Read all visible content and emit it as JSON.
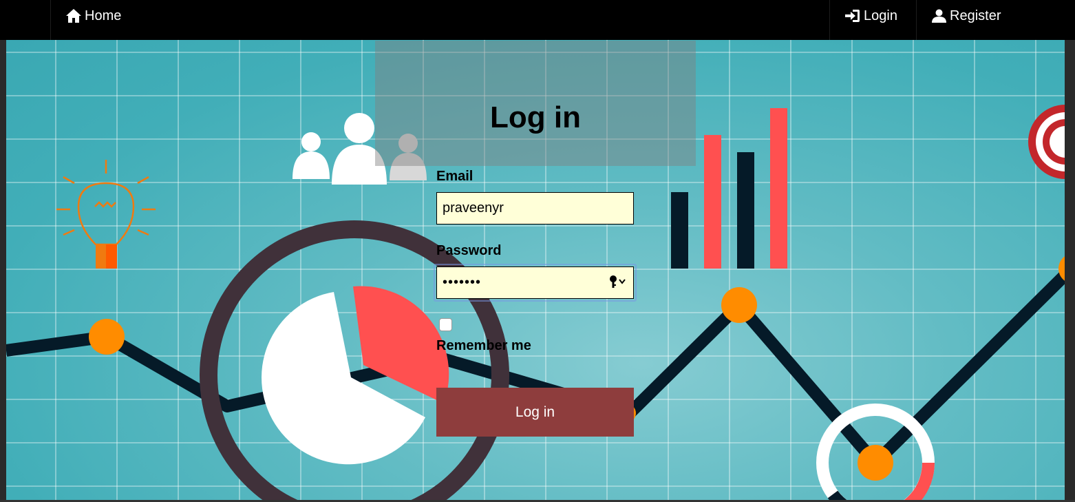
{
  "navbar": {
    "home_label": "Home",
    "login_label": "Login",
    "register_label": "Register"
  },
  "login_form": {
    "title": "Log in",
    "email_label": "Email",
    "email_value": "praveenyr",
    "password_label": "Password",
    "password_value": "•••••••",
    "remember_label": "Remember me",
    "remember_checked": false,
    "submit_label": "Log in"
  },
  "icons": [
    "home-icon",
    "login-icon",
    "user-icon",
    "key-icon",
    "chevron-down-icon"
  ],
  "colors": {
    "navbar_bg": "#000000",
    "background_teal": "#43aeb8",
    "input_bg": "#ffffd8",
    "button_bg": "#8e3d3d",
    "accent_orange": "#ff8c00",
    "accent_red": "#ff5050",
    "dark_navy": "#051a28"
  }
}
